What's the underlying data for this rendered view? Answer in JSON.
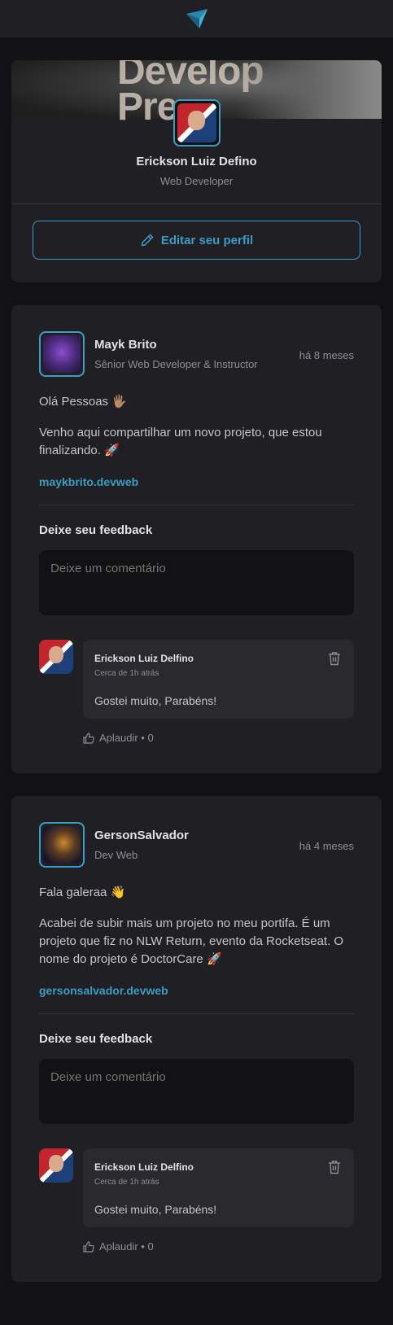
{
  "header": {
    "logo_icon": "ignite-logo-icon"
  },
  "profile": {
    "cover_text": "Develop\nPre",
    "name": "Erickson Luiz Defino",
    "role": "Web Developer",
    "edit_label": "Editar seu perfil"
  },
  "posts": [
    {
      "author": "Mayk Brito",
      "role": "Sênior Web Developer & Instructor",
      "time": "há 8 meses",
      "paragraphs": [
        "Olá Pessoas 🖐🏽",
        "Venho aqui compartilhar um novo projeto, que estou finalizando. 🚀"
      ],
      "link": "maykbrito.devweb",
      "feedback_title": "Deixe seu feedback",
      "comment_placeholder": "Deixe um comentário",
      "comment": {
        "author": "Erickson Luiz Delfino",
        "time": "Cerca de 1h atrás",
        "text": "Gostei muito, Parabéns!",
        "applaud": "Aplaudir • 0"
      }
    },
    {
      "author": "GersonSalvador",
      "role": "Dev Web",
      "time": "há 4 meses",
      "paragraphs": [
        "Fala galeraa 👋",
        "Acabei de subir mais um projeto no meu portifa. É um projeto que fiz no NLW Return, evento da Rocketseat. O nome do projeto é DoctorCare 🚀"
      ],
      "link": "gersonsalvador.devweb",
      "feedback_title": "Deixe seu feedback",
      "comment_placeholder": "Deixe um comentário",
      "comment": {
        "author": "Erickson Luiz Delfino",
        "time": "Cerca de 1h atrás",
        "text": "Gostei muito, Parabéns!",
        "applaud": "Aplaudir • 0"
      }
    }
  ],
  "colors": {
    "accent": "#3a9dc4",
    "card": "#202024",
    "background": "#121214"
  }
}
